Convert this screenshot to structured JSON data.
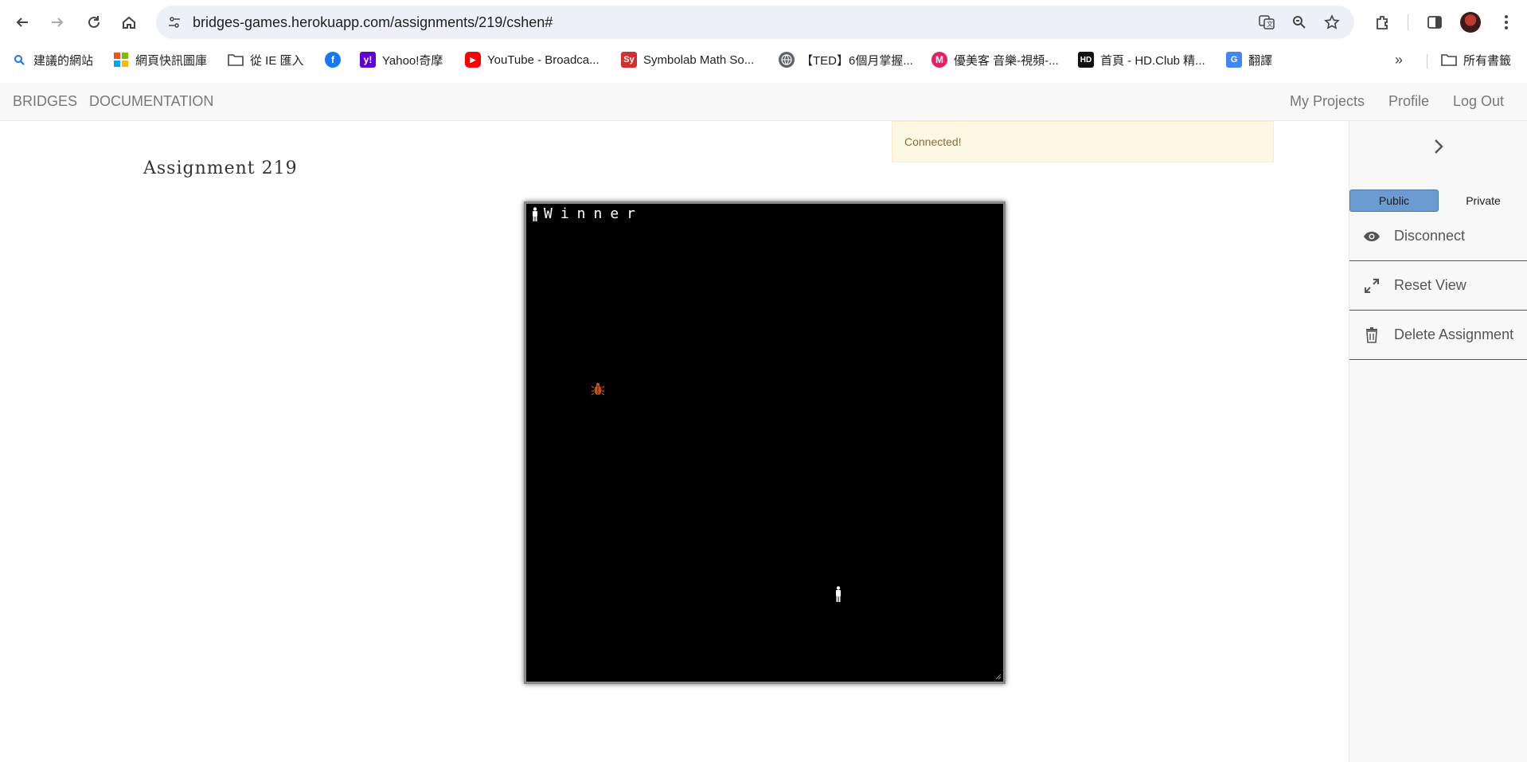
{
  "browser": {
    "url": "bridges-games.herokuapp.com/assignments/219/cshen#",
    "icons": [
      "back-arrow-icon",
      "forward-arrow-icon",
      "reload-icon",
      "home-icon",
      "site-info-icon",
      "translate-icon",
      "zoom-icon",
      "star-icon",
      "extensions-icon",
      "side-panel-icon",
      "avatar",
      "kebab-menu-icon"
    ]
  },
  "bookmarks": {
    "items": [
      {
        "label": "建議的網站",
        "icon": "search-icon"
      },
      {
        "label": "網頁快訊圖庫",
        "icon": "windows-logo-icon"
      },
      {
        "label": "從 IE 匯入",
        "icon": "folder-icon"
      },
      {
        "label": "",
        "icon": "facebook-icon"
      },
      {
        "label": "Yahoo!奇摩",
        "icon": "yahoo-icon"
      },
      {
        "label": "YouTube - Broadca...",
        "icon": "youtube-icon"
      },
      {
        "label": "Symbolab Math So...",
        "icon": "symbolab-icon"
      },
      {
        "label": "【TED】6個月掌握...",
        "icon": "globe-icon"
      },
      {
        "label": "優美客 音樂-視頻-...",
        "icon": "m-icon"
      },
      {
        "label": "首頁 - HD.Club 精...",
        "icon": "hd-icon"
      },
      {
        "label": "翻譯",
        "icon": "google-translate-icon"
      }
    ],
    "all_bookmarks": "所有書籤"
  },
  "navbar": {
    "brand": "BRIDGES",
    "documentation": "DOCUMENTATION",
    "my_projects": "My Projects",
    "profile": "Profile",
    "logout": "Log Out"
  },
  "alert": "Connected!",
  "page_title": "Assignment 219",
  "game": {
    "status_text": "Winner",
    "background": "#000000",
    "sprites": [
      "person-icon",
      "bug-icon",
      "person-icon"
    ]
  },
  "sidebar": {
    "public": "Public",
    "private": "Private",
    "disconnect": "Disconnect",
    "reset_view": "Reset View",
    "delete_assignment": "Delete Assignment"
  },
  "colors": {
    "public_active": "#6b9bd1",
    "alert_bg": "#fcf8e3",
    "alert_text": "#8a6d3b",
    "bug": "#c0521a"
  }
}
